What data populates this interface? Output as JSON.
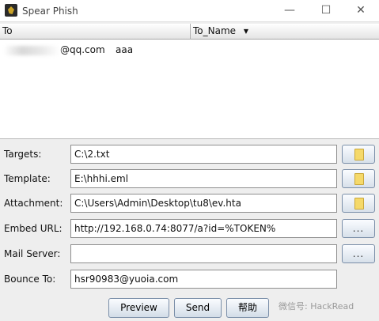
{
  "window": {
    "title": "Spear Phish",
    "minimize_glyph": "—",
    "maximize_glyph": "☐",
    "close_glyph": "✕",
    "icon": "spear-phish-app-icon"
  },
  "table": {
    "columns": [
      {
        "label": "To"
      },
      {
        "label": "To_Name",
        "sort_indicator": "▼"
      }
    ],
    "rows": [
      {
        "email": "@qq.com",
        "name": "aaa"
      }
    ]
  },
  "form": {
    "targets": {
      "label": "Targets:",
      "value": "C:\\2.txt",
      "button_icon": "folder-icon"
    },
    "template": {
      "label": "Template:",
      "value": "E:\\hhhi.eml",
      "button_icon": "folder-icon"
    },
    "attachment": {
      "label": "Attachment:",
      "value": "C:\\Users\\Admin\\Desktop\\tu8\\ev.hta",
      "button_icon": "folder-icon"
    },
    "embed_url": {
      "label": "Embed URL:",
      "value": "http://192.168.0.74:8077/a?id=%TOKEN%",
      "button_label": "..."
    },
    "mail_server": {
      "label": "Mail Server:",
      "value": "",
      "button_label": "..."
    },
    "bounce_to": {
      "label": "Bounce To:",
      "value": "hsr90983@yuoia.com"
    }
  },
  "buttons": {
    "preview": "Preview",
    "send": "Send",
    "help": "帮助"
  },
  "watermark": "微信号: HackRead"
}
